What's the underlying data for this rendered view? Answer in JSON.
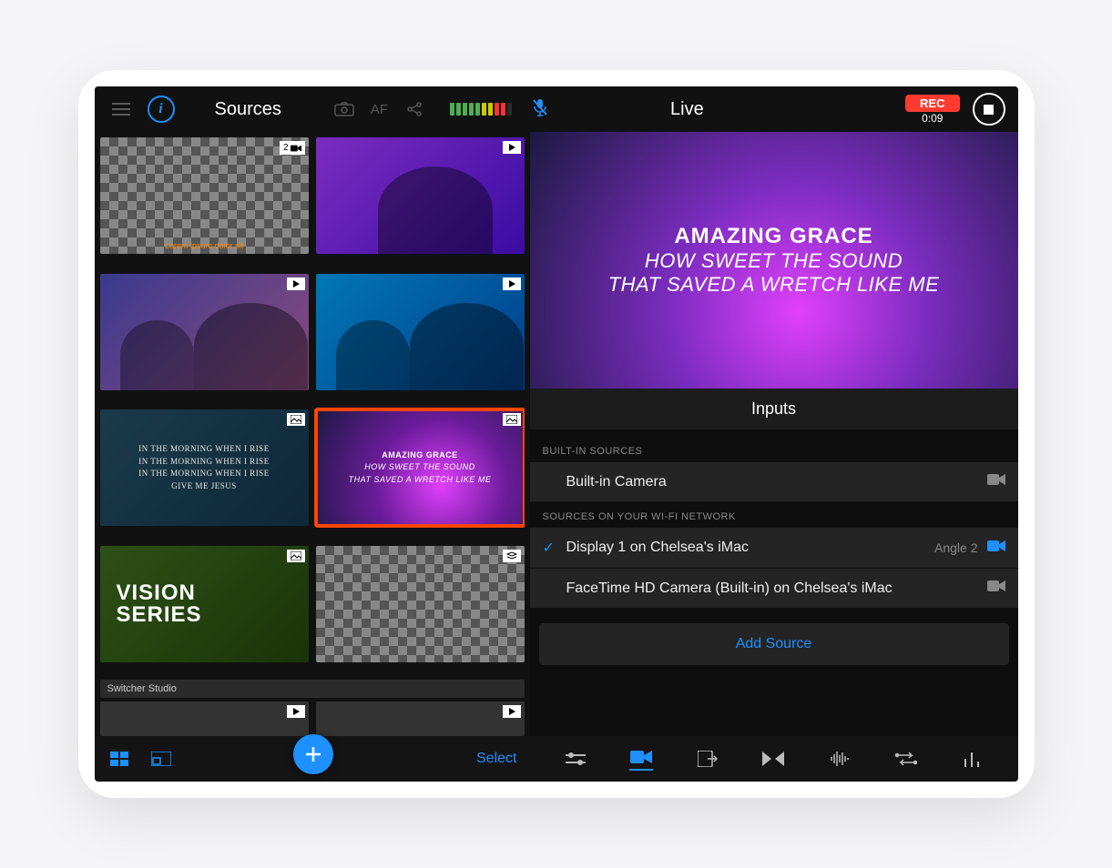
{
  "header": {
    "left_title": "Sources",
    "af_label": "AF",
    "live_title": "Live",
    "rec_label": "REC",
    "rec_time": "0:09"
  },
  "sources": {
    "group_label": "Switcher Studio",
    "thumbs": [
      {
        "text": "Lorem ipsum dolor sit",
        "badge_count": "2",
        "badge_type": "cam"
      },
      {
        "text": "",
        "badge_type": "play"
      },
      {
        "text": "",
        "badge_type": "play"
      },
      {
        "text": "",
        "badge_type": "play"
      },
      {
        "text": "IN THE MORNING WHEN I RISE\nIN THE MORNING WHEN I RISE\nIN THE MORNING WHEN I RISE\nGIVE ME JESUS",
        "badge_type": "img"
      },
      {
        "text": "AMAZING GRACE\nHOW SWEET THE SOUND\nTHAT SAVED A WRETCH LIKE ME",
        "badge_type": "img",
        "selected": true
      },
      {
        "text": "VISION\nSERIES",
        "badge_type": "img"
      },
      {
        "text": "",
        "badge_type": "stack"
      }
    ]
  },
  "live": {
    "line1": "AMAZING GRACE",
    "line2": "HOW SWEET THE SOUND",
    "line3": "THAT SAVED A WRETCH LIKE ME"
  },
  "inputs": {
    "title": "Inputs",
    "builtin_label": "BUILT-IN SOURCES",
    "builtin_item": "Built-in Camera",
    "wifi_label": "SOURCES ON YOUR WI-FI NETWORK",
    "items": [
      {
        "checked": true,
        "label": "Display 1 on Chelsea's iMac",
        "angle": "Angle 2",
        "active": true
      },
      {
        "checked": false,
        "label": "FaceTime HD Camera (Built-in) on Chelsea's iMac",
        "angle": "",
        "active": false
      }
    ],
    "add_label": "Add Source"
  },
  "bottom": {
    "select_label": "Select"
  }
}
